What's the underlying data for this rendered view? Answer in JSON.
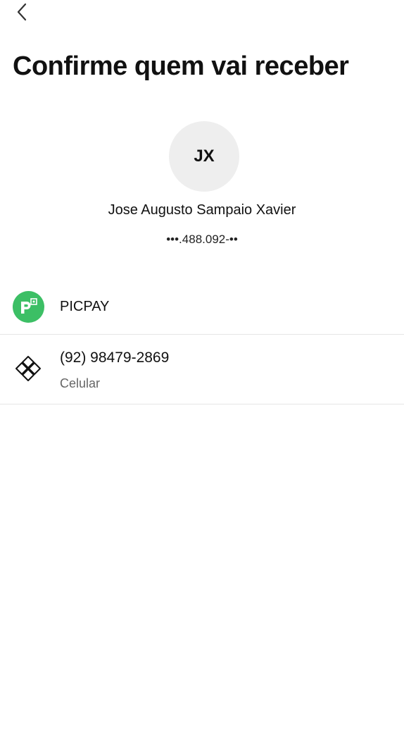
{
  "header": {
    "back_icon": "chevron-left-icon",
    "title": "Confirme quem vai receber"
  },
  "recipient": {
    "initials": "JX",
    "name": "Jose Augusto Sampaio Xavier",
    "document": "•••.488.092-••"
  },
  "bank": {
    "name": "PICPAY",
    "logo_icon": "picpay-logo",
    "logo_color": "#3cbf65"
  },
  "pix_key": {
    "icon": "pix-icon",
    "value": "(92) 98479-2869",
    "type": "Celular"
  }
}
